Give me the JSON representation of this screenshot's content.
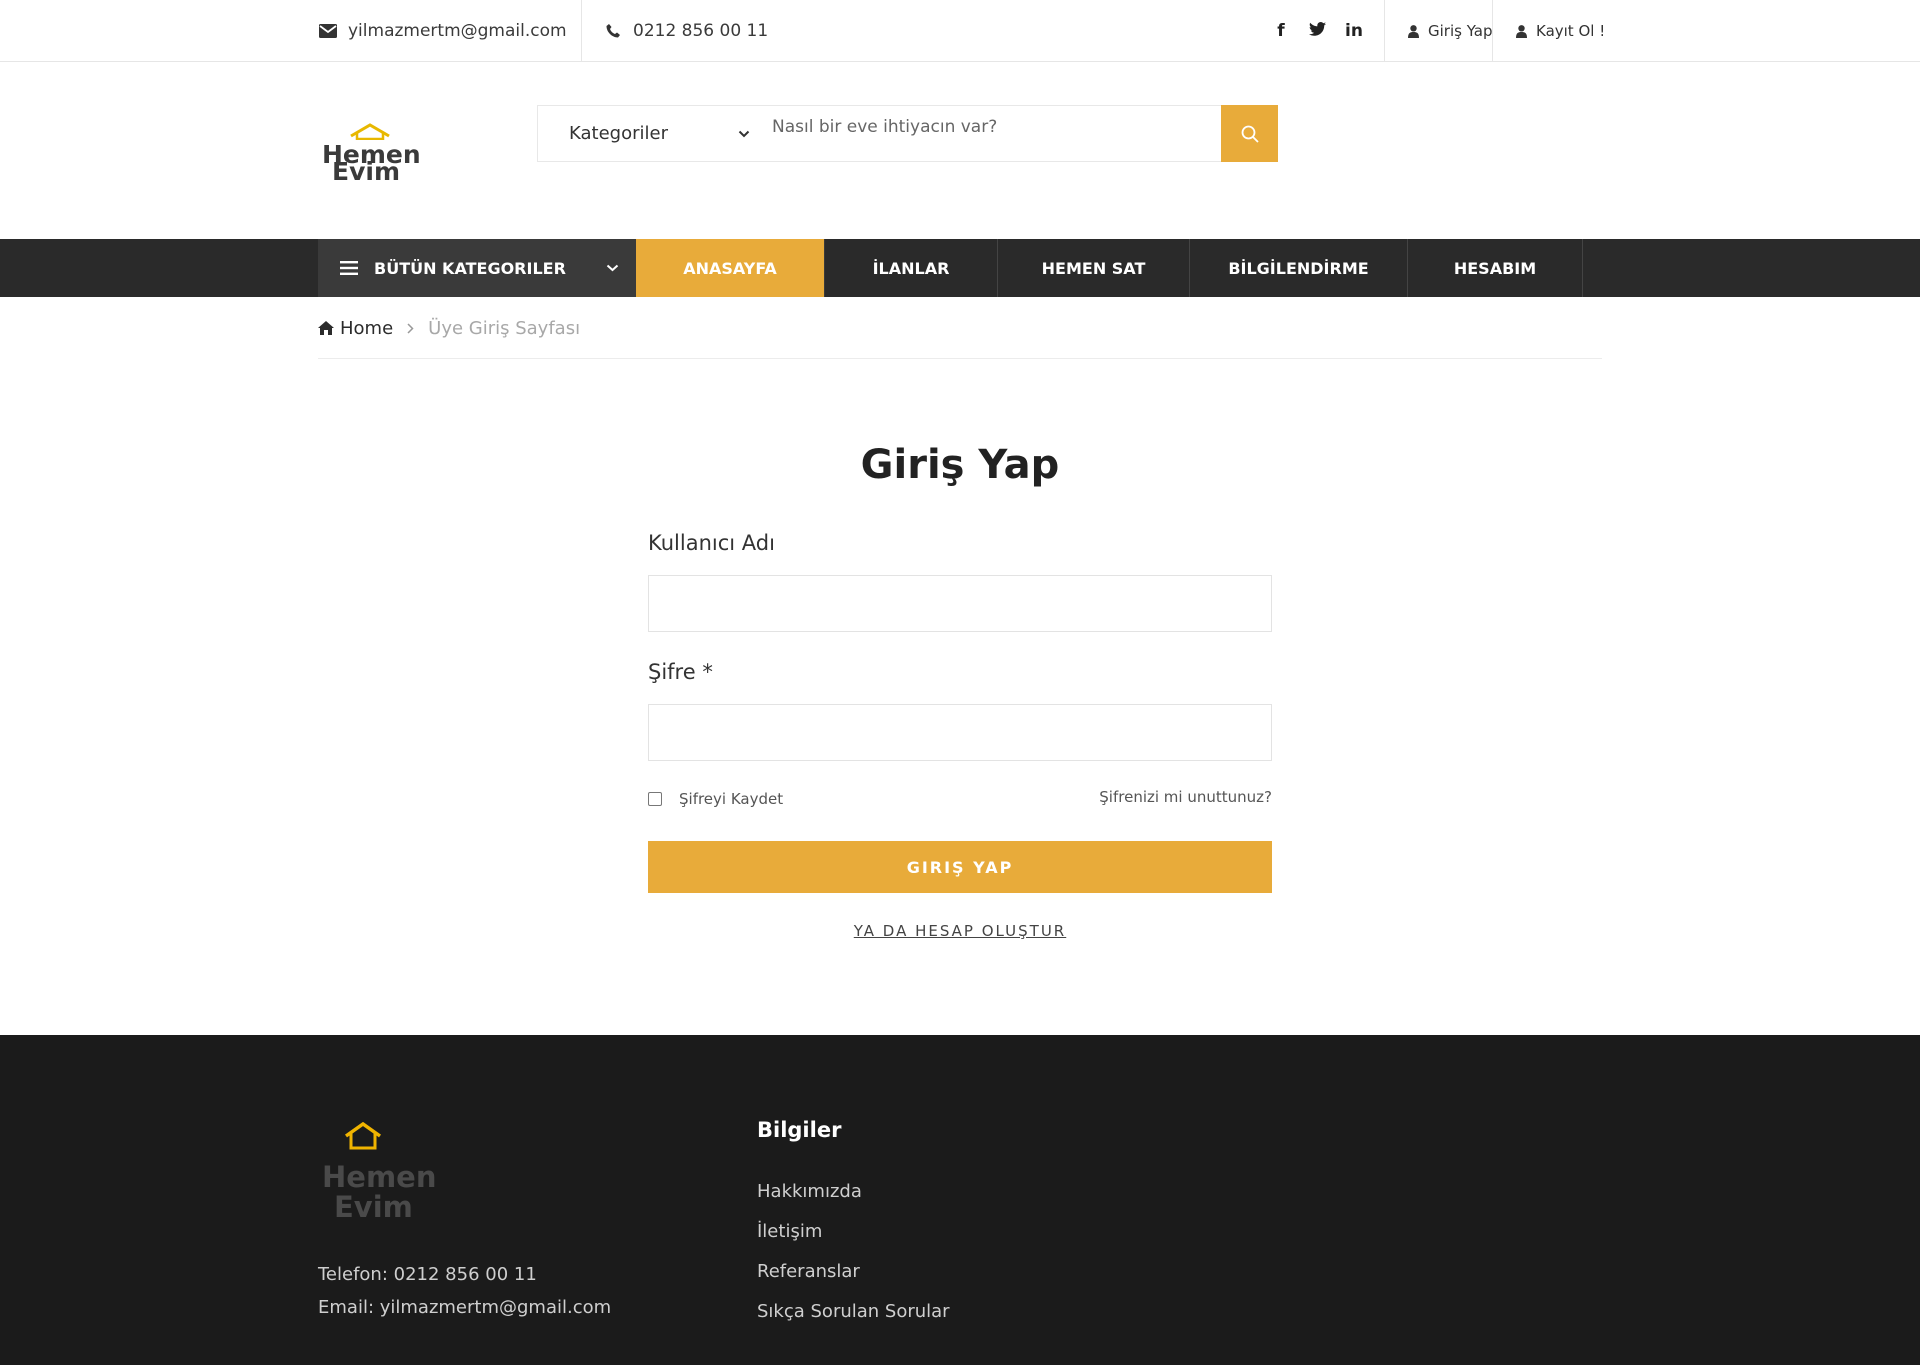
{
  "topbar": {
    "email": "yilmazmertm@gmail.com",
    "phone": "0212 856 00 11",
    "social": {
      "facebook": "f",
      "twitter": "twitter-bird",
      "linkedin": "in"
    },
    "login_label": "Giriş Yap",
    "register_label": "Kayıt Ol !"
  },
  "header": {
    "logo_line1": "Hemen",
    "logo_line2": "Evim",
    "category_select": "Kategoriler",
    "search_placeholder": "Nasıl bir eve ihtiyacın var?"
  },
  "nav": {
    "all_categories": "BÜTÜN KATEGORILER",
    "items": [
      "ANASAYFA",
      "İLANLAR",
      "HEMEN SAT",
      "BİLGİLENDİRME",
      "HESABIM"
    ],
    "active": "ANASAYFA"
  },
  "breadcrumb": {
    "home": "Home",
    "current": "Üye Giriş Sayfası"
  },
  "login": {
    "title": "Giriş Yap",
    "username_label": "Kullanıcı Adı",
    "password_label": "Şifre *",
    "remember_label": "Şifreyi Kaydet",
    "forgot_label": "Şifrenizi mi unuttunuz?",
    "submit_label": "GIRIŞ YAP",
    "create_label": "YA DA HESAP OLUŞTUR"
  },
  "footer": {
    "logo_line1": "Hemen",
    "logo_line2": "Evim",
    "phone": "Telefon: 0212 856 00 11",
    "email": "Email: yilmazmertm@gmail.com",
    "info_heading": "Bilgiler",
    "links": [
      "Hakkımızda",
      "İletişim",
      "Referanslar",
      "Sıkça Sorulan Sorular"
    ]
  },
  "colors": {
    "accent": "#e8ab3a",
    "nav_bg": "#2a2a2a",
    "footer_bg": "#1b1b1b"
  }
}
